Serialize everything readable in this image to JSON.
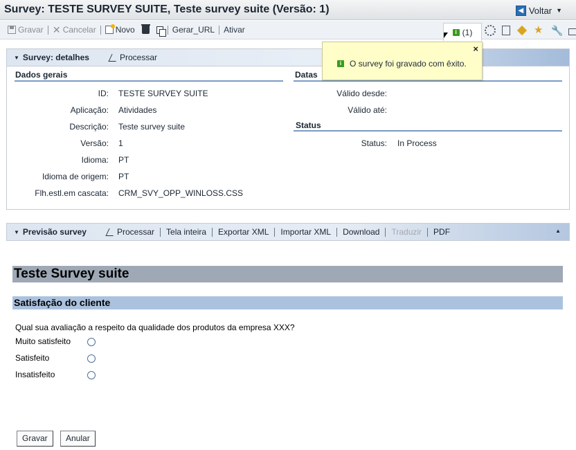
{
  "window": {
    "title": "Survey: TESTE SURVEY SUITE, Teste survey suite (Versão: 1)",
    "back_label": "Voltar"
  },
  "toolbar": {
    "save_label": "Gravar",
    "cancel_label": "Cancelar",
    "new_label": "Novo",
    "generate_url_label": "Gerar_URL",
    "activate_label": "Ativar",
    "message_count": "(1)"
  },
  "popover": {
    "close_label": "×",
    "message": "O survey foi gravado com êxito."
  },
  "details_panel": {
    "title": "Survey: detalhes",
    "edit_label": "Processar",
    "general_section": "Dados gerais",
    "dates_section": "Datas",
    "status_section": "Status",
    "fields": [
      {
        "label": "ID:",
        "value": "TESTE SURVEY SUITE"
      },
      {
        "label": "Aplicação:",
        "value": "Atividades"
      },
      {
        "label": "Descrição:",
        "value": "Teste survey suite"
      },
      {
        "label": "Versão:",
        "value": "1"
      },
      {
        "label": "Idioma:",
        "value": "PT"
      },
      {
        "label": "Idioma de origem:",
        "value": "PT"
      },
      {
        "label": "Flh.estl.em cascata:",
        "value": "CRM_SVY_OPP_WINLOSS.CSS"
      }
    ],
    "valid_from_label": "Válido desde:",
    "valid_to_label": "Válido até:",
    "status_label": "Status:",
    "status_value": "In Process"
  },
  "preview_panel": {
    "title": "Previsão survey",
    "actions": [
      "Processar",
      "Tela inteira",
      "Exportar XML",
      "Importar XML",
      "Download",
      "Traduzir",
      "PDF"
    ]
  },
  "survey": {
    "title": "Teste Survey suite",
    "section": "Satisfação do cliente",
    "question": "Qual sua avaliação a respeito da qualidade dos produtos da empresa XXX?",
    "options": [
      "Muito satisfeito",
      "Satisfeito",
      "Insatisfeito"
    ],
    "submit_label": "Gravar",
    "reset_label": "Anular"
  }
}
